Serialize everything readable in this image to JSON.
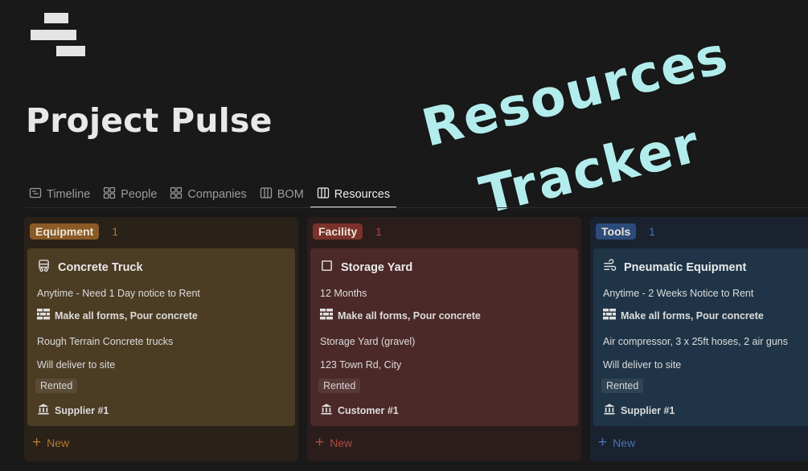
{
  "overlay": {
    "line1": "Resources",
    "line2": "Tracker"
  },
  "page": {
    "title": "Project Pulse"
  },
  "tabs": [
    {
      "label": "Timeline",
      "icon": "timeline-icon",
      "active": false
    },
    {
      "label": "People",
      "icon": "gallery-icon",
      "active": false
    },
    {
      "label": "Companies",
      "icon": "gallery-icon",
      "active": false
    },
    {
      "label": "BOM",
      "icon": "board-icon",
      "active": false
    },
    {
      "label": "Resources",
      "icon": "board-icon",
      "active": true
    }
  ],
  "columns": [
    {
      "tag": "Equipment",
      "count": "1",
      "new_label": "New",
      "colors": {
        "bg": "#2a2119",
        "tag_bg": "#8a5a27",
        "card": "#4c3c24",
        "accent": "#b37a2e"
      },
      "card": {
        "icon": "truck-icon",
        "title": "Concrete Truck",
        "availability": "Anytime - Need 1 Day notice to Rent",
        "tasks": "Make all forms, Pour concrete",
        "description": "Rough Terrain Concrete trucks",
        "delivery": "Will deliver to site",
        "status": "Rented",
        "supplier": "Supplier #1"
      }
    },
    {
      "tag": "Facility",
      "count": "1",
      "new_label": "New",
      "colors": {
        "bg": "#2b1d1c",
        "tag_bg": "#7a322b",
        "card": "#4b2928",
        "accent": "#b14a42"
      },
      "card": {
        "icon": "checkbox-icon",
        "title": "Storage Yard",
        "availability": "12 Months",
        "tasks": "Make all forms, Pour concrete",
        "description": "Storage Yard (gravel)",
        "delivery": "123 Town Rd, City",
        "status": "Rented",
        "supplier": "Customer #1"
      }
    },
    {
      "tag": "Tools",
      "count": "1",
      "new_label": "New",
      "colors": {
        "bg": "#1a2230",
        "tag_bg": "#2d4b7a",
        "card": "#1f3547",
        "accent": "#4a73b3"
      },
      "card": {
        "icon": "wind-icon",
        "title": "Pneumatic Equipment",
        "availability": "Anytime - 2 Weeks Notice to Rent",
        "tasks": "Make all forms, Pour concrete",
        "description": "Air compressor, 3 x 25ft hoses, 2 air guns",
        "delivery": "Will deliver to site",
        "status": "Rented",
        "supplier": "Supplier #1"
      }
    }
  ]
}
